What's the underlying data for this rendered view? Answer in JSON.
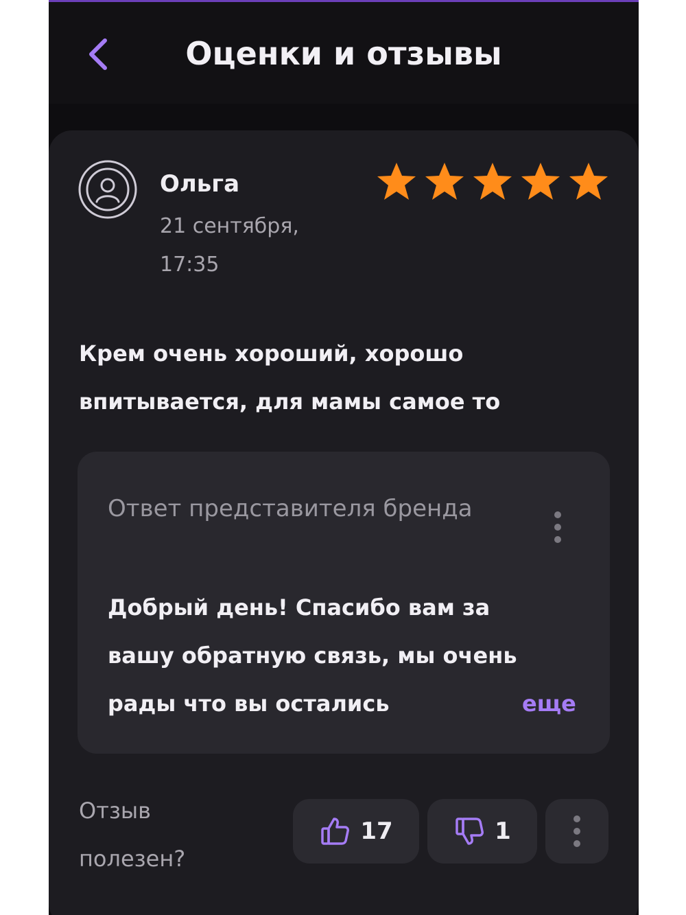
{
  "header": {
    "title": "Оценки и отзывы",
    "back_icon": "chevron-left-icon"
  },
  "review": {
    "author": "Ольга",
    "date": "21 сентября, 17:35",
    "rating": 5,
    "rating_max": 5,
    "text": "Крем очень хороший, хорошо впитывается, для мамы самое то"
  },
  "reply": {
    "title": "Ответ представителя бренда",
    "text": "Добрый день! Спасибо вам за вашу обратную связь, мы очень рады что вы остались",
    "more_label": "еще"
  },
  "feedback": {
    "label": "Отзыв полезен?",
    "likes": "17",
    "dislikes": "1"
  },
  "colors": {
    "accent": "#a57cf5",
    "star": "#ff8c1a",
    "background": "#0e0d10",
    "card": "#1d1c21",
    "reply_card": "#29282e"
  }
}
